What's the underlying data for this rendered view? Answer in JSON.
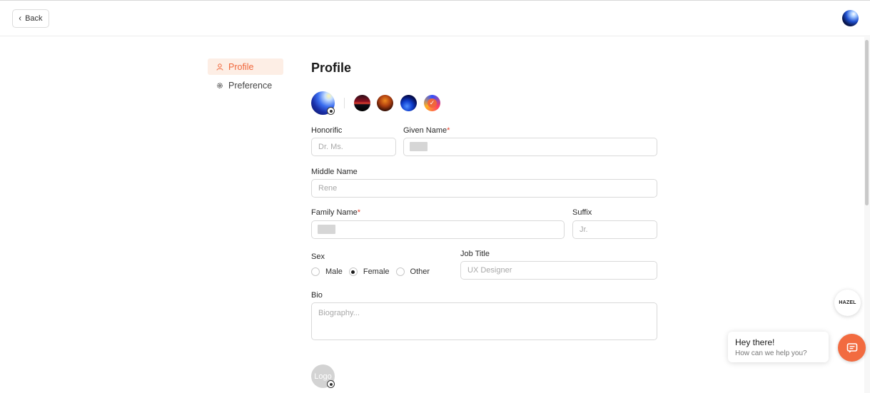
{
  "header": {
    "back_label": "Back"
  },
  "sidebar": {
    "items": [
      {
        "label": "Profile",
        "icon": "user-icon",
        "active": true
      },
      {
        "label": "Preference",
        "icon": "gear-icon",
        "active": false
      }
    ]
  },
  "main": {
    "title": "Profile",
    "avatar_presets": [
      "preset-1",
      "preset-2",
      "preset-3",
      "preset-4"
    ],
    "selected_preset": 4,
    "fields": {
      "honorific": {
        "label": "Honorific",
        "placeholder": "Dr. Ms.",
        "value": ""
      },
      "given_name": {
        "label": "Given Name",
        "required": "*",
        "value": ""
      },
      "middle_name": {
        "label": "Middle Name",
        "placeholder": "Rene",
        "value": ""
      },
      "family_name": {
        "label": "Family Name",
        "required": "*",
        "value": ""
      },
      "suffix": {
        "label": "Suffix",
        "placeholder": "Jr.",
        "value": ""
      },
      "sex": {
        "label": "Sex",
        "options": [
          "Male",
          "Female",
          "Other"
        ],
        "selected": "Female"
      },
      "job_title": {
        "label": "Job Title",
        "placeholder": "UX Designer",
        "value": ""
      },
      "bio": {
        "label": "Bio",
        "placeholder": "Biography...",
        "value": ""
      }
    },
    "logo_placeholder": "Logo"
  },
  "widget": {
    "hazel_label": "HAZEL",
    "chat_title": "Hey there!",
    "chat_subtitle": "How can we help you?"
  },
  "colors": {
    "accent": "#f0663a",
    "active_bg": "#fdeee5"
  }
}
